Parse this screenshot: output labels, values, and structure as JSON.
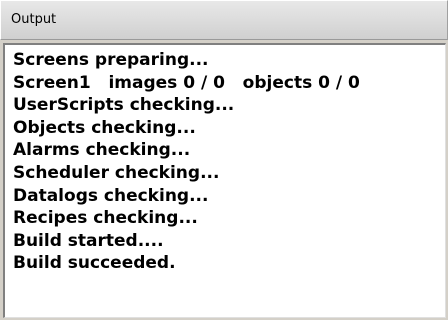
{
  "panel": {
    "title": "Output",
    "lines": [
      "Screens preparing...",
      "Screen1   images 0 / 0   objects 0 / 0",
      "UserScripts checking...",
      "Objects checking...",
      "Alarms checking...",
      "Scheduler checking...",
      "Datalogs checking...",
      "Recipes checking...",
      "Build started....",
      "Build succeeded."
    ]
  }
}
